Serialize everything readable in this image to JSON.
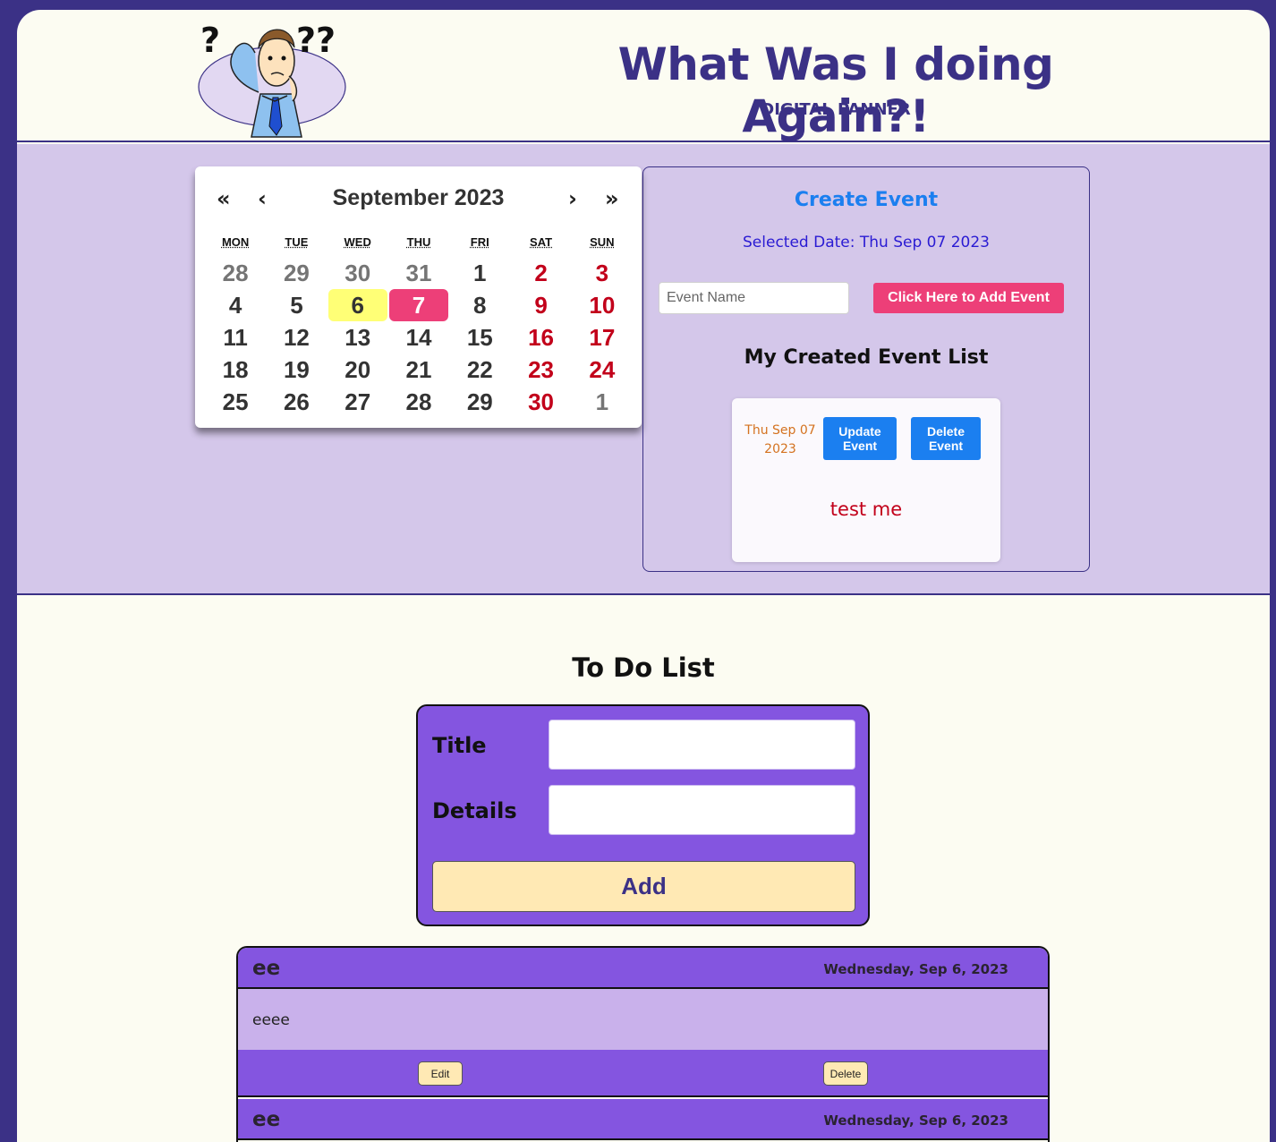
{
  "header": {
    "title": "What Was I doing Again?!",
    "subtitle": "DIGITAL PANNER",
    "logo_marks": "??"
  },
  "calendar": {
    "nav": {
      "prev_year": "«",
      "prev_month": "‹",
      "next_month": "›",
      "next_year": "»"
    },
    "month_label": "September 2023",
    "weekdays": [
      "MON",
      "TUE",
      "WED",
      "THU",
      "FRI",
      "SAT",
      "SUN"
    ],
    "weeks": [
      [
        "28",
        "29",
        "30",
        "31",
        "1",
        "2",
        "3"
      ],
      [
        "4",
        "5",
        "6",
        "7",
        "8",
        "9",
        "10"
      ],
      [
        "11",
        "12",
        "13",
        "14",
        "15",
        "16",
        "17"
      ],
      [
        "18",
        "19",
        "20",
        "21",
        "22",
        "23",
        "24"
      ],
      [
        "25",
        "26",
        "27",
        "28",
        "29",
        "30",
        "1"
      ]
    ],
    "today": "6",
    "selected": "7",
    "colors": {
      "weekend": "#c2001a",
      "today_bg": "#ffff76",
      "selected_bg": "#ed3f78",
      "other_month": "#757575"
    }
  },
  "events": {
    "heading": "Create Event",
    "selected_date_text": "Selected Date: Thu Sep 07 2023",
    "input_placeholder": "Event Name",
    "add_button": "Click Here to Add Event",
    "list_heading": "My Created Event List",
    "items": [
      {
        "date_line1": "Thu Sep 07",
        "date_line2": "2023",
        "update_line1": "Update",
        "update_line2": "Event",
        "delete_line1": "Delete",
        "delete_line2": "Event",
        "name": "test me"
      }
    ]
  },
  "todo": {
    "heading": "To Do List",
    "form": {
      "title_label": "Title",
      "details_label": "Details",
      "title_value": "",
      "details_value": "",
      "add_button": "Add"
    },
    "items": [
      {
        "title": "ee",
        "date": "Wednesday, Sep 6, 2023",
        "details": "eeee",
        "edit_label": "Edit",
        "delete_label": "Delete"
      },
      {
        "title": "ee",
        "date": "Wednesday, Sep 6, 2023"
      }
    ]
  },
  "colors": {
    "brand": "#3b3186",
    "band": "#d4c7ea",
    "accent_pink": "#ed3f78",
    "accent_blue": "#1b7ff0",
    "todo_purple": "#8455e0",
    "todo_body": "#c9b1eb",
    "button_cream": "#ffe9b4"
  }
}
